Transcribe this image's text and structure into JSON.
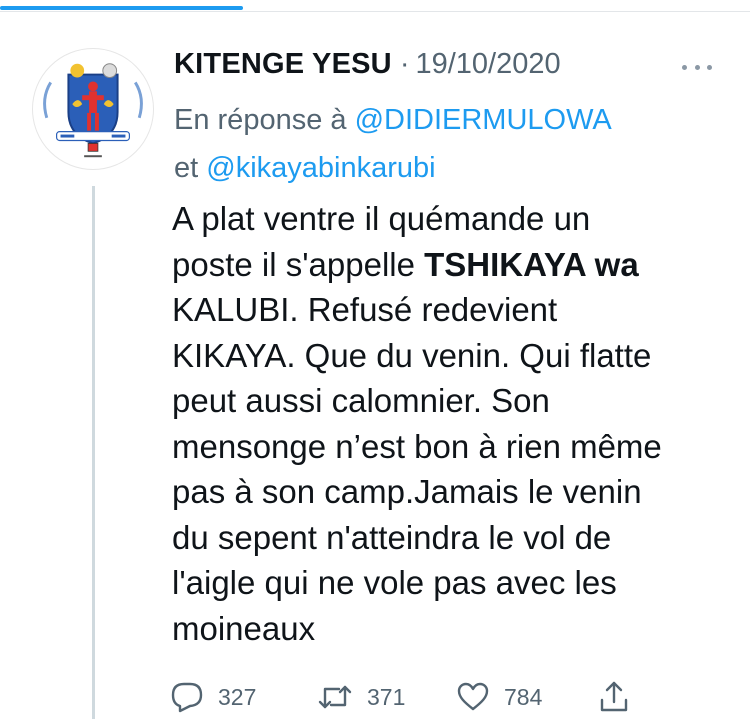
{
  "tweet": {
    "author_name": "KITENGE YESU",
    "separator": "·",
    "date": "19/10/2020",
    "reply_prefix": "En réponse à",
    "reply_to_1": "@DIDIERMULOWA",
    "reply_joiner": "et",
    "reply_to_2": "@kikayabinkarubi",
    "body_lines": [
      "A plat ventre il quémande un",
      "poste il s'appelle ",
      "KALUBI. Refusé redevient",
      "KIKAYA. Que du venin. Qui flatte",
      "peut aussi calomnier. Son",
      "mensonge n’est bon à rien même",
      "pas à son camp.Jamais le venin",
      "du sepent n'atteindra le vol de",
      "l'aigle qui ne vole pas avec les",
      "moineaux"
    ],
    "body_bold": "TSHIKAYA wa",
    "avatar_icon": "coat-of-arms-avatar",
    "more_icon": "more-dots-icon"
  },
  "actions": {
    "reply_count": "327",
    "retweet_count": "371",
    "like_count": "784",
    "reply_icon": "reply-icon",
    "retweet_icon": "retweet-icon",
    "like_icon": "heart-icon",
    "share_icon": "share-icon"
  },
  "colors": {
    "accent": "#1d9bf0",
    "secondary_text": "#536471",
    "primary_text": "#0f1419",
    "thread_line": "#cfd9de"
  }
}
